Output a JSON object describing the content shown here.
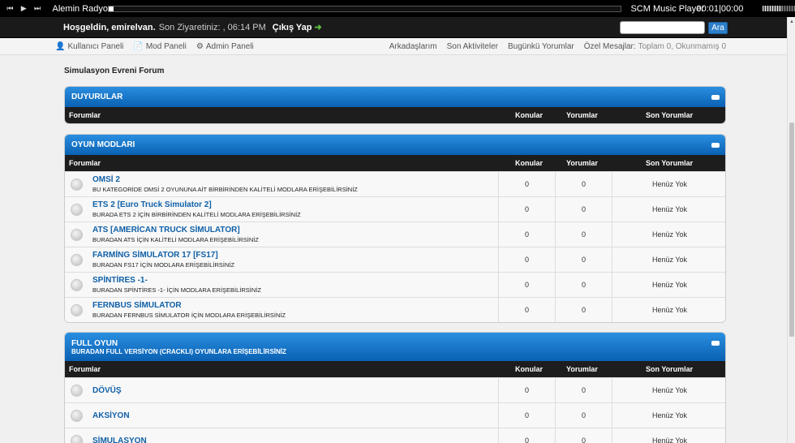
{
  "player": {
    "radio_name": "Alemin Radyosu",
    "player_name": "SCM Music Player",
    "time": "00:01|00:00",
    "progress": 0.0,
    "volume": 0.6,
    "prev_icon": "skip-back-icon",
    "play_icon": "play-icon",
    "next_icon": "skip-forward-icon"
  },
  "header": {
    "welcome": "Hoşgeldin, emirelvan.",
    "last_visit": "Son Ziyaretiniz: , 06:14 PM",
    "logout": "Çıkış Yap",
    "search_value": "",
    "search_button": "Ara"
  },
  "nav": {
    "user_panel": "Kullanıcı Paneli",
    "mod_panel": "Mod Paneli",
    "admin_panel": "Admin Paneli",
    "friends": "Arkadaşlarım",
    "recent_activity": "Son Aktiviteler",
    "today_posts": "Bugünkü Yorumlar",
    "pm_label": "Özel Mesajlar:",
    "pm_status": "Toplam 0, Okunmamış 0"
  },
  "breadcrumb": "Simulasyon Evreni Forum",
  "columns": {
    "forums": "Forumlar",
    "threads": "Konular",
    "posts": "Yorumlar",
    "last_post": "Son Yorumlar"
  },
  "sections": [
    {
      "title": "DUYURULAR",
      "subtitle": "",
      "forums": []
    },
    {
      "title": "OYUN MODLARI",
      "subtitle": "",
      "forums": [
        {
          "name": "OMSİ 2",
          "desc": "BU KATEGORİDE OMSİ 2 OYUNUNA AİT BİRBİRİNDEN KALİTELİ MODLARA ERİŞEBİLİRSİNİZ",
          "threads": "0",
          "posts": "0",
          "last": "Henüz Yok"
        },
        {
          "name": "ETS 2 [Euro Truck Simulator 2]",
          "desc": "BURADA ETS 2 İÇİN BİRBİRİNDEN KALİTELİ MODLARA ERİŞEBİLİRSİNİZ",
          "threads": "0",
          "posts": "0",
          "last": "Henüz Yok"
        },
        {
          "name": "ATS [AMERİCAN TRUCK SİMULATOR]",
          "desc": "BURADAN ATS İÇİN KALİTELİ MODLARA ERİŞEBİLİRSİNİZ",
          "threads": "0",
          "posts": "0",
          "last": "Henüz Yok"
        },
        {
          "name": "FARMİNG SİMULATOR 17 [FS17]",
          "desc": "BURADAN FS17 İÇİN MODLARA ERİŞEBİLİRSİNİZ",
          "threads": "0",
          "posts": "0",
          "last": "Henüz Yok"
        },
        {
          "name": "SPİNTİRES -1-",
          "desc": "BURADAN SPİNTİRES -1- İÇİN MODLARA ERİŞEBİLİRSİNİZ",
          "threads": "0",
          "posts": "0",
          "last": "Henüz Yok"
        },
        {
          "name": "FERNBUS SİMULATOR",
          "desc": "BURADAN FERNBUS SİMULATOR İÇİN MODLARA ERİŞEBİLİRSİNİZ",
          "threads": "0",
          "posts": "0",
          "last": "Henüz Yok"
        }
      ]
    },
    {
      "title": "FULL OYUN",
      "subtitle": "BURADAN FULL VERSİYON (CRACKLI) OYUNLARA ERİŞEBİLİRSİNİZ",
      "forums": [
        {
          "name": "DÖVÜŞ",
          "desc": "",
          "threads": "0",
          "posts": "0",
          "last": "Henüz Yok"
        },
        {
          "name": "AKSİYON",
          "desc": "",
          "threads": "0",
          "posts": "0",
          "last": "Henüz Yok"
        },
        {
          "name": "SİMULASYON",
          "desc": "",
          "threads": "0",
          "posts": "0",
          "last": "Henüz Yok"
        }
      ]
    }
  ]
}
